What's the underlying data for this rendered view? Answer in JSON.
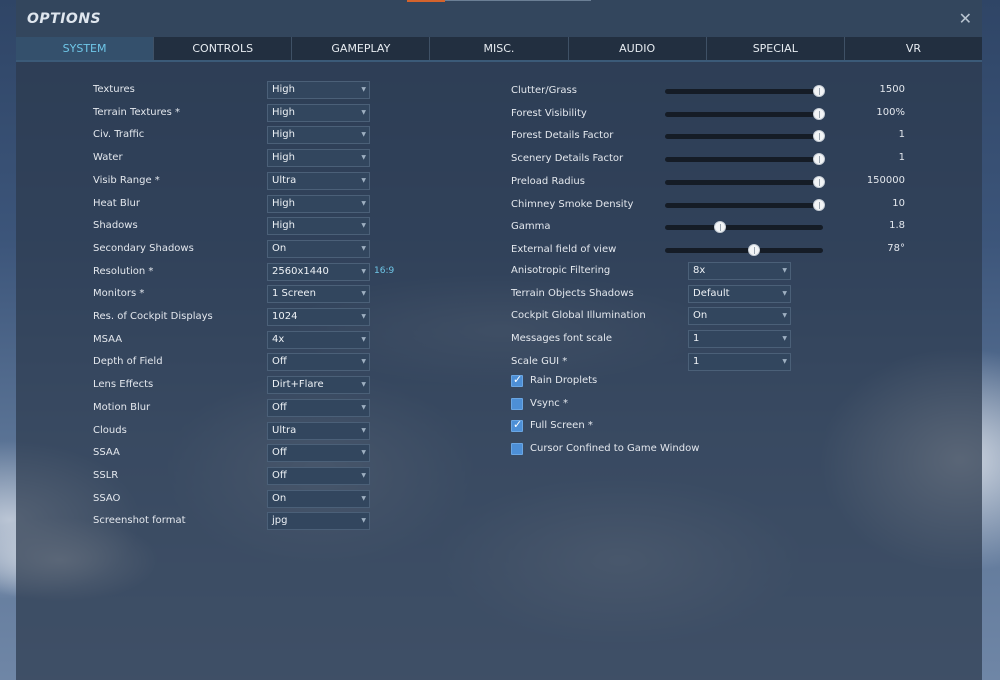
{
  "window": {
    "title": "OPTIONS",
    "close_icon": "✕"
  },
  "tabs": [
    {
      "label": "SYSTEM",
      "active": true
    },
    {
      "label": "CONTROLS",
      "active": false
    },
    {
      "label": "GAMEPLAY",
      "active": false
    },
    {
      "label": "MISC.",
      "active": false
    },
    {
      "label": "AUDIO",
      "active": false
    },
    {
      "label": "SPECIAL",
      "active": false
    },
    {
      "label": "VR",
      "active": false
    }
  ],
  "left_settings": [
    {
      "label": "Textures",
      "value": "High"
    },
    {
      "label": "Terrain Textures *",
      "value": "High"
    },
    {
      "label": "Civ. Traffic",
      "value": "High"
    },
    {
      "label": "Water",
      "value": "High"
    },
    {
      "label": "Visib Range *",
      "value": "Ultra"
    },
    {
      "label": "Heat Blur",
      "value": "High"
    },
    {
      "label": "Shadows",
      "value": "High"
    },
    {
      "label": "Secondary Shadows",
      "value": "On"
    },
    {
      "label": "Resolution *",
      "value": "2560x1440"
    },
    {
      "label": "Monitors *",
      "value": "1 Screen"
    },
    {
      "label": "Res. of Cockpit Displays",
      "value": "1024"
    },
    {
      "label": "MSAA",
      "value": "4x"
    },
    {
      "label": "Depth of Field",
      "value": "Off"
    },
    {
      "label": "Lens Effects",
      "value": "Dirt+Flare"
    },
    {
      "label": "Motion Blur",
      "value": "Off"
    },
    {
      "label": "Clouds",
      "value": "Ultra"
    },
    {
      "label": "SSAA",
      "value": "Off"
    },
    {
      "label": "SSLR",
      "value": "Off"
    },
    {
      "label": "SSAO",
      "value": "On"
    },
    {
      "label": "Screenshot format",
      "value": "jpg"
    }
  ],
  "resolution_ratio": "16:9",
  "sliders": [
    {
      "label": "Clutter/Grass",
      "value": "1500",
      "fraction": 1.0
    },
    {
      "label": "Forest Visibility",
      "value": "100%",
      "fraction": 1.0
    },
    {
      "label": "Forest Details Factor",
      "value": "1",
      "fraction": 1.0
    },
    {
      "label": "Scenery Details Factor",
      "value": "1",
      "fraction": 1.0
    },
    {
      "label": "Preload Radius",
      "value": "150000",
      "fraction": 1.0
    },
    {
      "label": "Chimney Smoke Density",
      "value": "10",
      "fraction": 1.0
    },
    {
      "label": "Gamma",
      "value": "1.8",
      "fraction": 0.33
    },
    {
      "label": "External field of view",
      "value": "78°",
      "fraction": 0.56
    }
  ],
  "right_selects": [
    {
      "label": "Anisotropic Filtering",
      "value": "8x"
    },
    {
      "label": "Terrain Objects Shadows",
      "value": "Default"
    },
    {
      "label": "Cockpit Global Illumination",
      "value": "On"
    },
    {
      "label": "Messages font scale",
      "value": "1"
    },
    {
      "label": "Scale GUI *",
      "value": "1"
    }
  ],
  "checkboxes": [
    {
      "label": "Rain Droplets",
      "checked": true
    },
    {
      "label": "Vsync *",
      "checked": false
    },
    {
      "label": "Full Screen *",
      "checked": true
    },
    {
      "label": "Cursor Confined to Game Window",
      "checked": false
    }
  ],
  "icons": {
    "chevron": "▼",
    "check": "✓"
  },
  "colors": {
    "accent": "#6fc7e8",
    "checkbox": "#4d8fd6",
    "tab_active_bg": "#34506c"
  }
}
